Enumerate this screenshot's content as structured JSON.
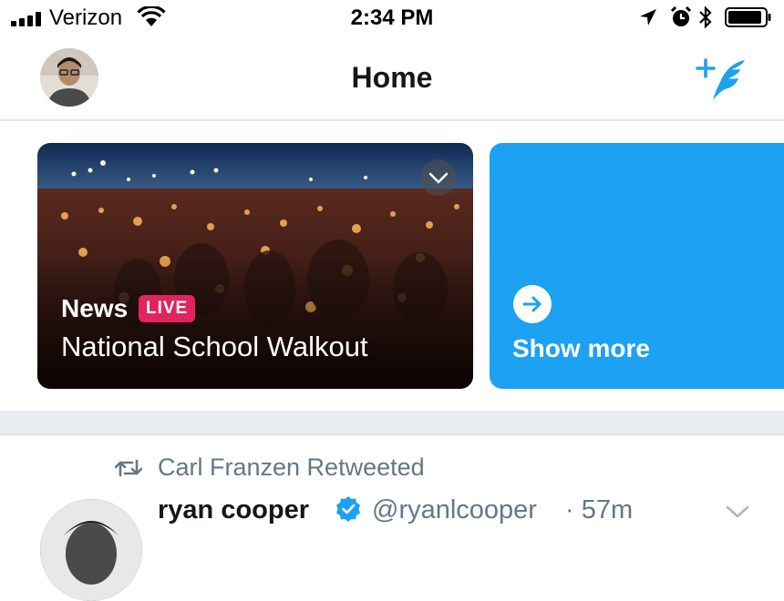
{
  "status_bar": {
    "carrier": "Verizon",
    "time": "2:34 PM",
    "icons": [
      "signal-bars-icon",
      "wifi-icon",
      "location-arrow-icon",
      "alarm-clock-icon",
      "bluetooth-icon",
      "battery-icon"
    ]
  },
  "nav": {
    "title": "Home",
    "avatar": "profile-avatar",
    "compose_icon": "compose-tweet-icon"
  },
  "carousel": {
    "news_card": {
      "category": "News",
      "badge": "LIVE",
      "headline": "National School Walkout",
      "menu_icon": "chevron-down-icon"
    },
    "more_card": {
      "label": "Show more",
      "icon": "arrow-right-icon"
    }
  },
  "tweet": {
    "retweeted_by": "Carl Franzen Retweeted",
    "author_name": "ryan cooper",
    "verified": true,
    "handle": "@ryanlcooper",
    "time": "57m",
    "menu_icon": "chevron-down-icon"
  },
  "colors": {
    "accent": "#1da1f2",
    "live": "#e0245e",
    "secondary_text": "#657786",
    "divider": "#e6ecf0"
  }
}
